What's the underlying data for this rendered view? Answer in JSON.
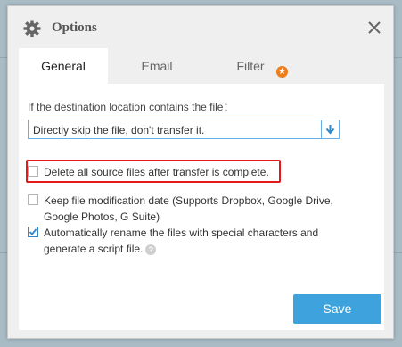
{
  "dialog": {
    "title": "Options",
    "title_icon": "gear-icon",
    "close_icon": "close-icon"
  },
  "tabs": [
    {
      "label": "General",
      "active": true
    },
    {
      "label": "Email",
      "active": false
    },
    {
      "label": "Filter",
      "active": false,
      "badge_icon": "star-icon",
      "badge_glyph": "★"
    }
  ],
  "general": {
    "prompt": "If the destination location contains the file：",
    "conflict_select": {
      "value": "Directly skip the file, don't transfer it.",
      "arrow_icon": "arrow-down-icon"
    },
    "options": [
      {
        "label": "Delete all source files after transfer is complete.",
        "checked": false,
        "highlighted": true
      },
      {
        "label": "Keep file modification date (Supports Dropbox, Google Drive, Google Photos, G Suite)",
        "checked": false
      },
      {
        "label": "Automatically rename the files with special characters and generate a script file.",
        "checked": true,
        "help_icon": "question-icon",
        "help_glyph": "?"
      }
    ]
  },
  "save_label": "Save",
  "colors": {
    "accent": "#3ea3dd",
    "highlight_border": "#e5191a",
    "badge": "#ee7d1c",
    "backdrop": "#a9bcc6"
  }
}
